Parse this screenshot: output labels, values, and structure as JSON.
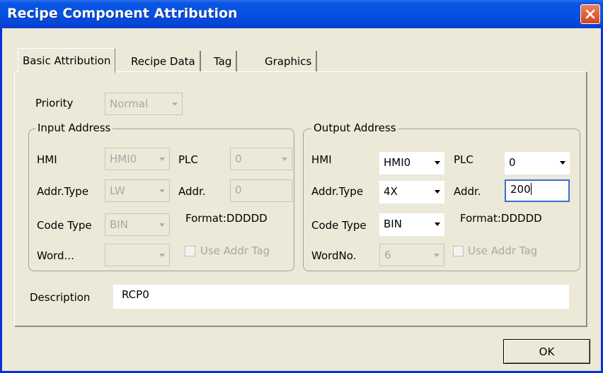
{
  "window": {
    "title": "Recipe Component Attribution",
    "close_icon": "close-icon"
  },
  "tabs": [
    {
      "label": "Basic Attribution",
      "active": true
    },
    {
      "label": "Recipe Data",
      "active": false
    },
    {
      "label": "Tag",
      "active": false
    },
    {
      "label": "Graphics",
      "active": false
    }
  ],
  "priority": {
    "label": "Priority",
    "value": "Normal"
  },
  "input_address": {
    "legend": "Input Address",
    "hmi_label": "HMI",
    "hmi_value": "HMI0",
    "plc_label": "PLC",
    "plc_value": "0",
    "addr_type_label": "Addr.Type",
    "addr_type_value": "LW",
    "addr_label": "Addr.",
    "addr_value": "0",
    "code_type_label": "Code Type",
    "code_type_value": "BIN",
    "format_text": "Format:DDDDD",
    "word_label": "Word...",
    "word_value": "",
    "use_addr_tag_label": "Use Addr Tag"
  },
  "output_address": {
    "legend": "Output Address",
    "hmi_label": "HMI",
    "hmi_value": "HMI0",
    "plc_label": "PLC",
    "plc_value": "0",
    "addr_type_label": "Addr.Type",
    "addr_type_value": "4X",
    "addr_label": "Addr.",
    "addr_value": "200",
    "code_type_label": "Code Type",
    "code_type_value": "BIN",
    "format_text": "Format:DDDDD",
    "word_no_label": "WordNo.",
    "word_no_value": "6",
    "use_addr_tag_label": "Use Addr Tag"
  },
  "description": {
    "label": "Description",
    "value": "RCP0"
  },
  "ok_button": {
    "label": "OK"
  }
}
